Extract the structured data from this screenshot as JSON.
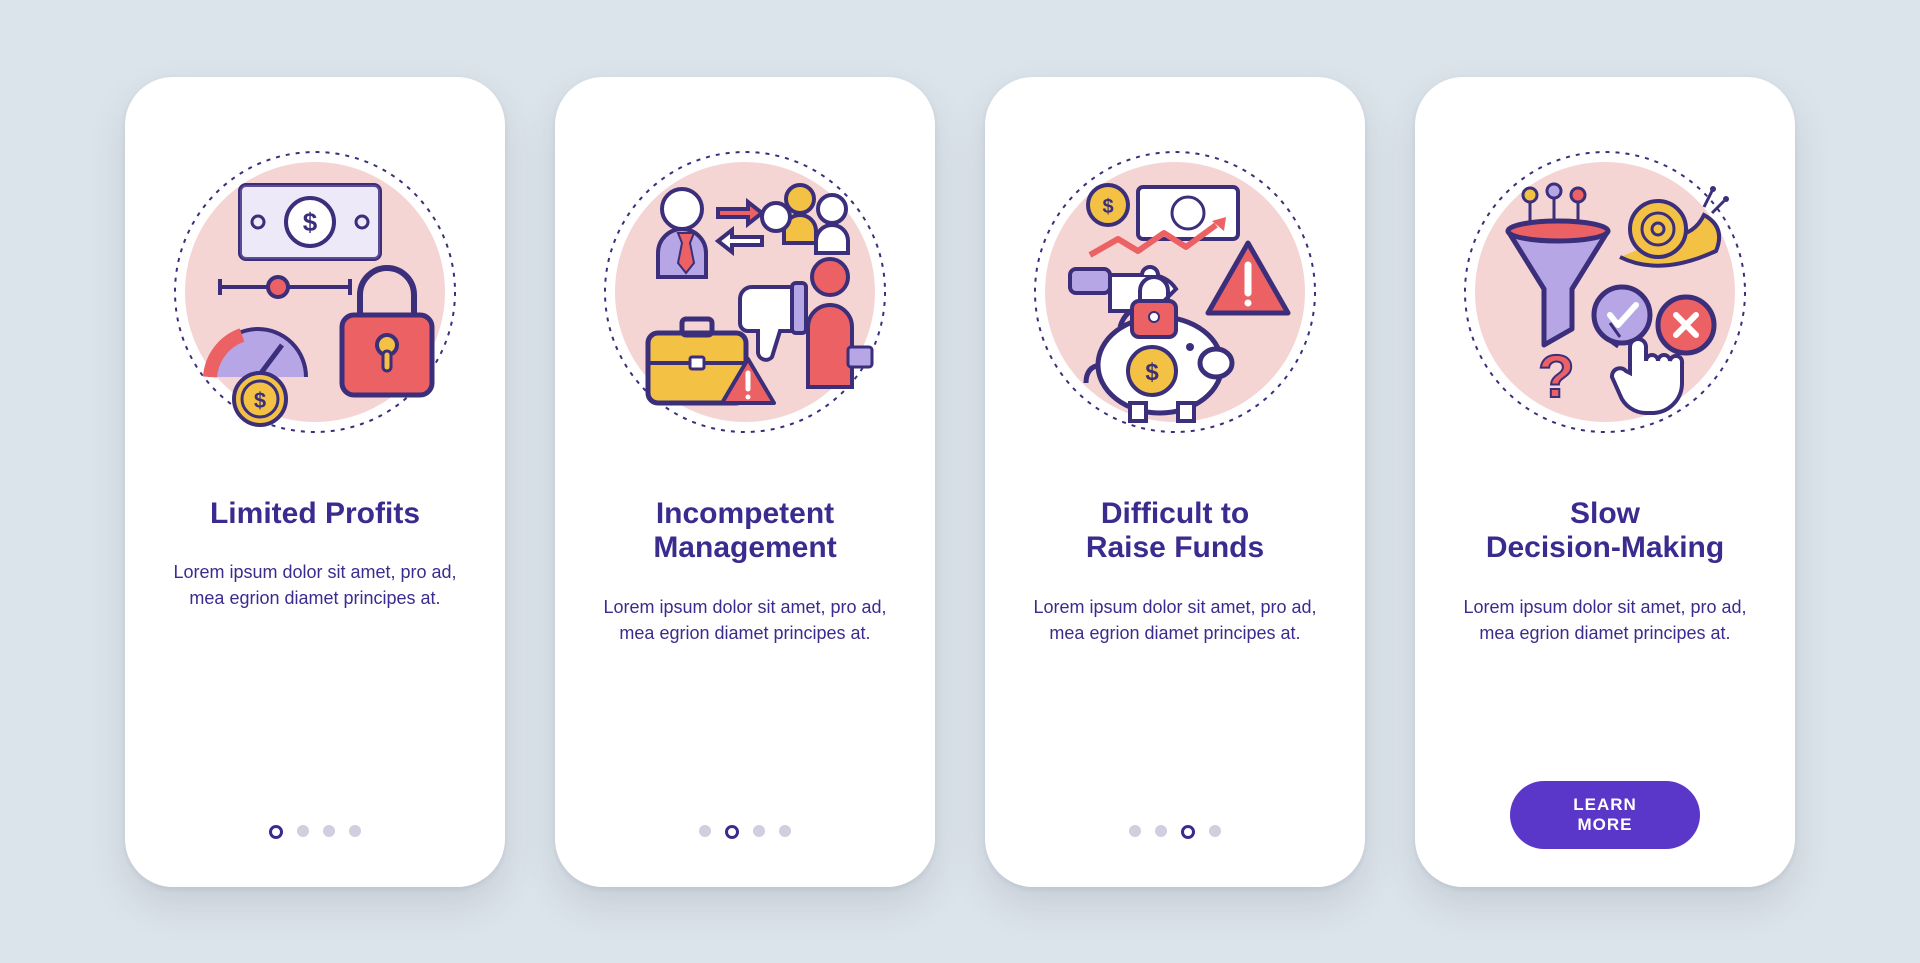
{
  "colors": {
    "bg": "#dce4eb",
    "card": "#ffffff",
    "primary": "#3a2c8f",
    "accentPurple": "#5a37c8",
    "softPink": "#f5d5d3",
    "red": "#ec6164",
    "yellow": "#f3c244",
    "white": "#ffffff",
    "lilac": "#b6a6e6",
    "stroke": "#3b2e7a"
  },
  "screens": [
    {
      "id": "limited-profits",
      "title": "Limited Profits",
      "description": "Lorem ipsum dolor sit amet, pro ad, mea egrion diamet principes at.",
      "activeDot": 0,
      "hasCTA": false,
      "icons": [
        "money-icon",
        "dashboard-icon",
        "coin-icon",
        "padlock-icon"
      ]
    },
    {
      "id": "incompetent-management",
      "title": "Incompetent\nManagement",
      "description": "Lorem ipsum dolor sit amet, pro ad, mea egrion diamet principes at.",
      "activeDot": 1,
      "hasCTA": false,
      "icons": [
        "person-icon",
        "group-icon",
        "briefcase-icon",
        "warning-icon",
        "thumbs-down-icon",
        "arrows-icon"
      ]
    },
    {
      "id": "difficult-to-raise-funds",
      "title": "Difficult to\nRaise Funds",
      "description": "Lorem ipsum dolor sit amet, pro ad, mea egrion diamet principes at.",
      "activeDot": 2,
      "hasCTA": false,
      "icons": [
        "coin-icon",
        "chart-icon",
        "hand-icon",
        "warning-icon",
        "piggy-bank-icon",
        "padlock-icon"
      ]
    },
    {
      "id": "slow-decision-making",
      "title": "Slow\nDecision-Making",
      "description": "Lorem ipsum dolor sit amet, pro ad, mea egrion diamet principes at.",
      "activeDot": 3,
      "hasCTA": true,
      "ctaLabel": "LEARN MORE",
      "icons": [
        "pins-icon",
        "snail-icon",
        "funnel-icon",
        "check-icon",
        "cross-icon",
        "question-icon",
        "pointer-icon"
      ]
    }
  ],
  "dotCount": 4
}
